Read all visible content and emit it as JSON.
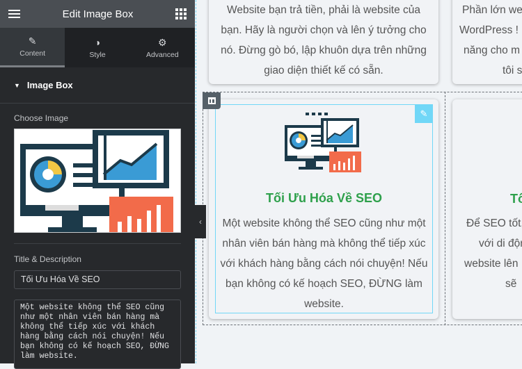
{
  "panel": {
    "title": "Edit Image Box",
    "menu_icon": "hamburger-icon",
    "apps_icon": "grid-icon",
    "tabs": [
      {
        "label": "Content",
        "icon": "pencil-icon",
        "active": true
      },
      {
        "label": "Style",
        "icon": "contrast-icon"
      },
      {
        "label": "Advanced",
        "icon": "gear-icon"
      }
    ],
    "section": "Image Box",
    "choose_image_label": "Choose Image",
    "title_desc_label": "Title & Description",
    "title_value": "Tối Ưu Hóa Về SEO",
    "description_value": "Một website không thể SEO cũng như một nhân viên bán hàng mà không thể tiếp xúc với khách hàng bằng cách nói chuyện! Nếu bạn không có kế hoạch SEO, ĐỪNG làm website."
  },
  "canvas": {
    "top_left_card": "Website bạn trả tiền, phải là website của bạn. Hãy là người chọn và lên ý tưởng cho nó. Đừng gò bó, lập khuôn dựa trên những giao diện thiết kế có sẵn.",
    "top_right_lines": [
      "Phần lớn we",
      "WordPress !",
      "năng cho m",
      "tôi s"
    ],
    "selected_card": {
      "title": "Tối Ưu Hóa Về SEO",
      "text": "Một website không thể SEO cũng như một nhân viên bán hàng mà không thể tiếp xúc với khách hàng bằng cách nói chuyện! Nếu bạn không có kế hoạch SEO, ĐỪNG làm website."
    },
    "right_card": {
      "title": "Tố",
      "lines": [
        "Để SEO tốt,",
        "với di độn",
        "website lên",
        "sẽ"
      ]
    }
  },
  "colors": {
    "accent": "#71d7f7",
    "title_green": "#2ea04b"
  }
}
